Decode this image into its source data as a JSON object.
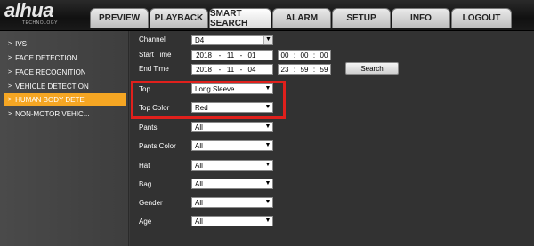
{
  "logo": {
    "brand": "alhua",
    "tag": "TECHNOLOGY"
  },
  "tabs": [
    {
      "label": "PREVIEW"
    },
    {
      "label": "PLAYBACK"
    },
    {
      "label": "SMART SEARCH"
    },
    {
      "label": "ALARM"
    },
    {
      "label": "SETUP"
    },
    {
      "label": "INFO"
    },
    {
      "label": "LOGOUT"
    }
  ],
  "active_tab": "SMART SEARCH",
  "sidebar": {
    "items": [
      {
        "label": "IVS"
      },
      {
        "label": "FACE DETECTION"
      },
      {
        "label": "FACE RECOGNITION"
      },
      {
        "label": "VEHICLE DETECTION"
      },
      {
        "label": "HUMAN BODY DETE"
      },
      {
        "label": "NON-MOTOR VEHIC..."
      }
    ],
    "active": "HUMAN BODY DETE"
  },
  "form": {
    "channel": {
      "label": "Channel",
      "value": "D4"
    },
    "start_time": {
      "label": "Start Time",
      "year": "2018",
      "month": "11",
      "day": "01",
      "hh": "00",
      "mm": "00",
      "ss": "00"
    },
    "end_time": {
      "label": "End Time",
      "year": "2018",
      "month": "11",
      "day": "04",
      "hh": "23",
      "mm": "59",
      "ss": "59"
    },
    "search_label": "Search",
    "top": {
      "label": "Top",
      "value": "Long Sleeve"
    },
    "top_color": {
      "label": "Top Color",
      "value": "Red"
    },
    "pants": {
      "label": "Pants",
      "value": "All"
    },
    "pants_color": {
      "label": "Pants Color",
      "value": "All"
    },
    "hat": {
      "label": "Hat",
      "value": "All"
    },
    "bag": {
      "label": "Bag",
      "value": "All"
    },
    "gender": {
      "label": "Gender",
      "value": "All"
    },
    "age": {
      "label": "Age",
      "value": "All"
    },
    "date_sep": "-",
    "time_sep": ":"
  },
  "colors": {
    "accent": "#f5a623",
    "highlight": "#e0201c"
  }
}
